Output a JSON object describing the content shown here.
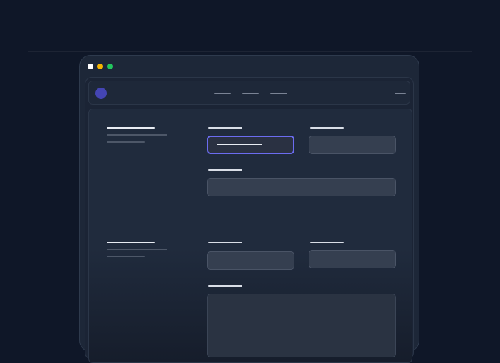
{
  "colors": {
    "page_background": "#0f1728",
    "window_background": "#1d2738",
    "accent": "#6b6cf0",
    "logo": "#4445b3",
    "traffic_close": "#ffffff",
    "traffic_minimize": "#f5b400",
    "traffic_maximize": "#22c55e"
  },
  "window": {
    "controls": [
      "close",
      "minimize",
      "maximize"
    ]
  },
  "navbar": {
    "logo_icon": "circle-logo-icon",
    "items": [
      "",
      "",
      ""
    ],
    "trailing_item": ""
  },
  "sections": [
    {
      "title": "",
      "description": "",
      "fields": [
        {
          "label": "",
          "value": "",
          "state": "focused"
        },
        {
          "label": "",
          "value": "",
          "state": "default"
        },
        {
          "label": "",
          "value": "",
          "state": "default",
          "width": "full"
        }
      ]
    },
    {
      "title": "",
      "description": "",
      "fields": [
        {
          "label": "",
          "value": "",
          "state": "default"
        },
        {
          "label": "",
          "value": "",
          "state": "default"
        },
        {
          "label": "",
          "value": "",
          "state": "default",
          "type": "textarea"
        }
      ]
    }
  ]
}
